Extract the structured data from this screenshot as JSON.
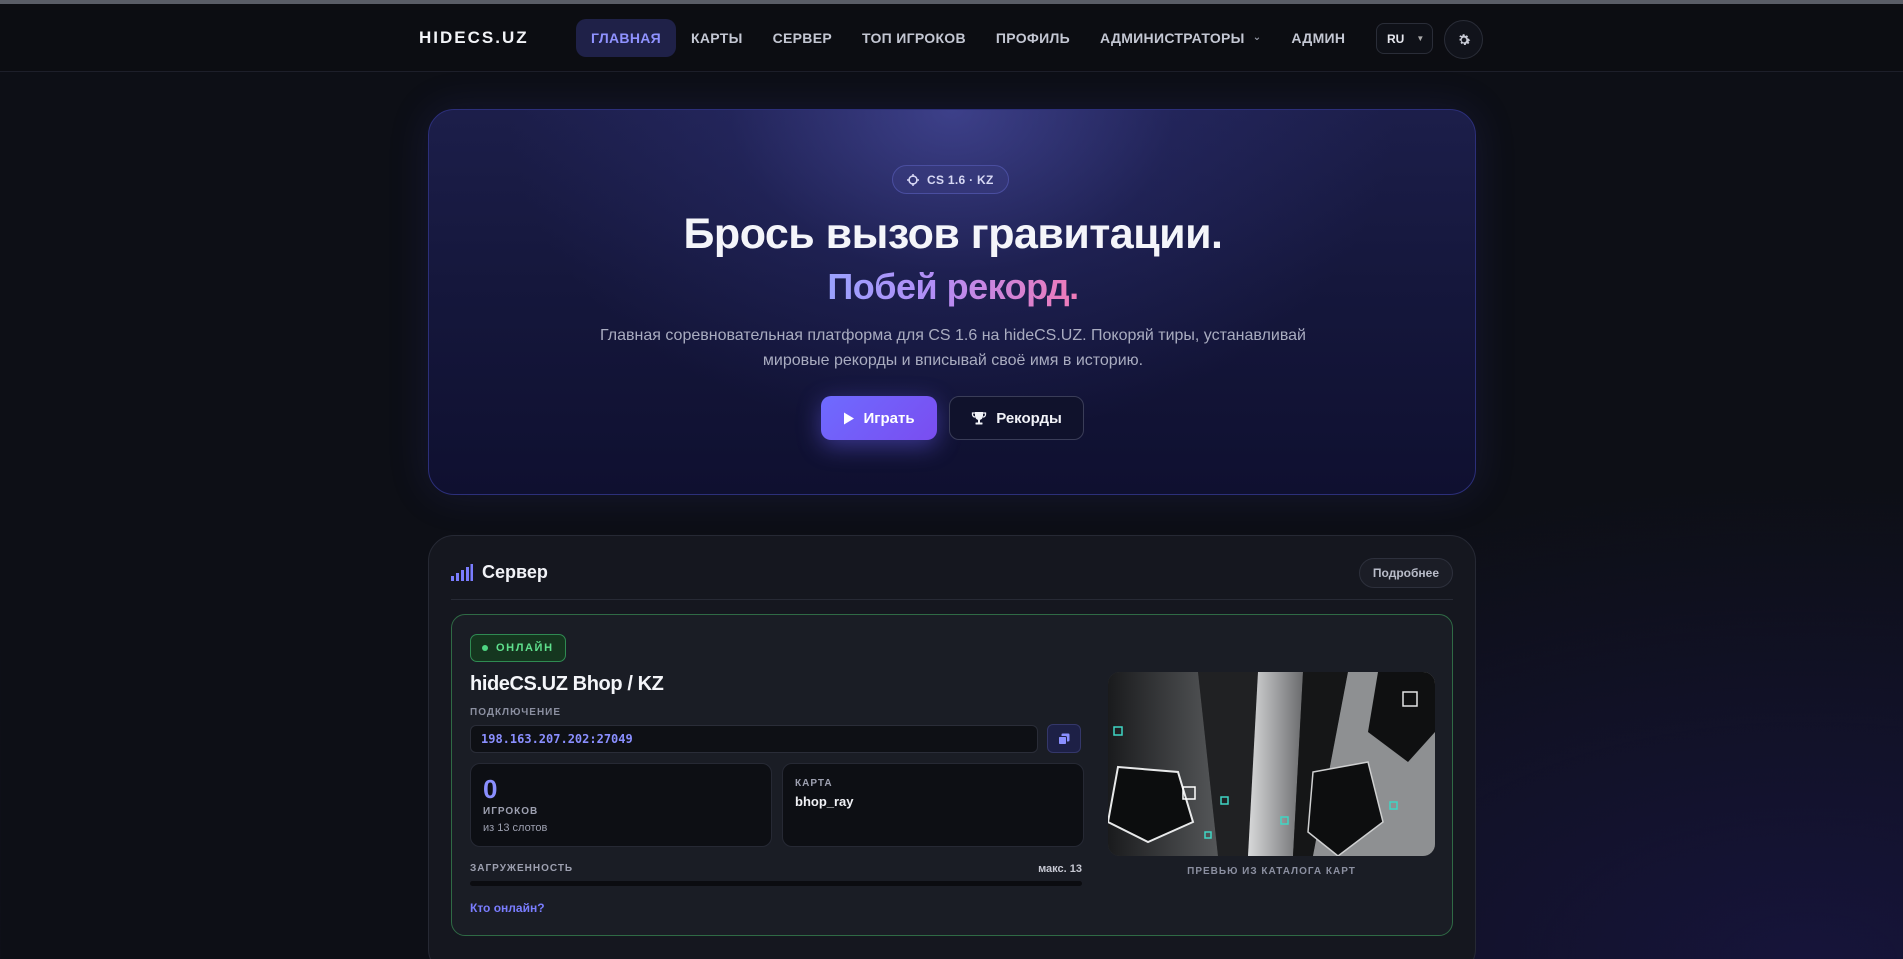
{
  "nav": {
    "logo": "HIDECS.UZ",
    "items": [
      {
        "label": "ГЛАВНАЯ",
        "active": true
      },
      {
        "label": "КАРТЫ"
      },
      {
        "label": "СЕРВЕР"
      },
      {
        "label": "ТОП ИГРОКОВ"
      },
      {
        "label": "ПРОФИЛЬ"
      },
      {
        "label": "АДМИНИСТРАТОРЫ",
        "dropdown": true
      },
      {
        "label": "АДМИН"
      }
    ],
    "language": "RU",
    "theme_icon": "gear-icon"
  },
  "hero": {
    "badge": "CS 1.6 · KZ",
    "badge_icon": "crosshair-icon",
    "title": "Брось вызов гравитации.",
    "subtitle": "Побей рекорд.",
    "description": "Главная соревновательная платформа для CS 1.6 на hideCS.UZ. Покоряй тиры, устанавливай мировые рекорды и вписывай своё имя в историю.",
    "play_label": "Играть",
    "records_label": "Рекорды"
  },
  "server": {
    "section_title": "Сервер",
    "more_label": "Подробнее",
    "status": "ОНЛАЙН",
    "name": "hideCS.UZ Bhop / KZ",
    "connect_label": "ПОДКЛЮЧЕНИЕ",
    "address": "198.163.207.202:27049",
    "players_count": "0",
    "players_label": "ИГРОКОВ",
    "players_slots": "из 13 слотов",
    "map_label": "КАРТА",
    "map_value": "bhop_ray",
    "load_label": "ЗАГРУЖЕННОСТЬ",
    "load_max": "макс. 13",
    "load_fraction": 0,
    "who_online": "Кто онлайн?",
    "preview_caption": "ПРЕВЬЮ ИЗ КАТАЛОГА КАРТ"
  },
  "colors": {
    "accent": "#6e6bff",
    "online": "#4ed582",
    "background": "#0d0f16"
  }
}
